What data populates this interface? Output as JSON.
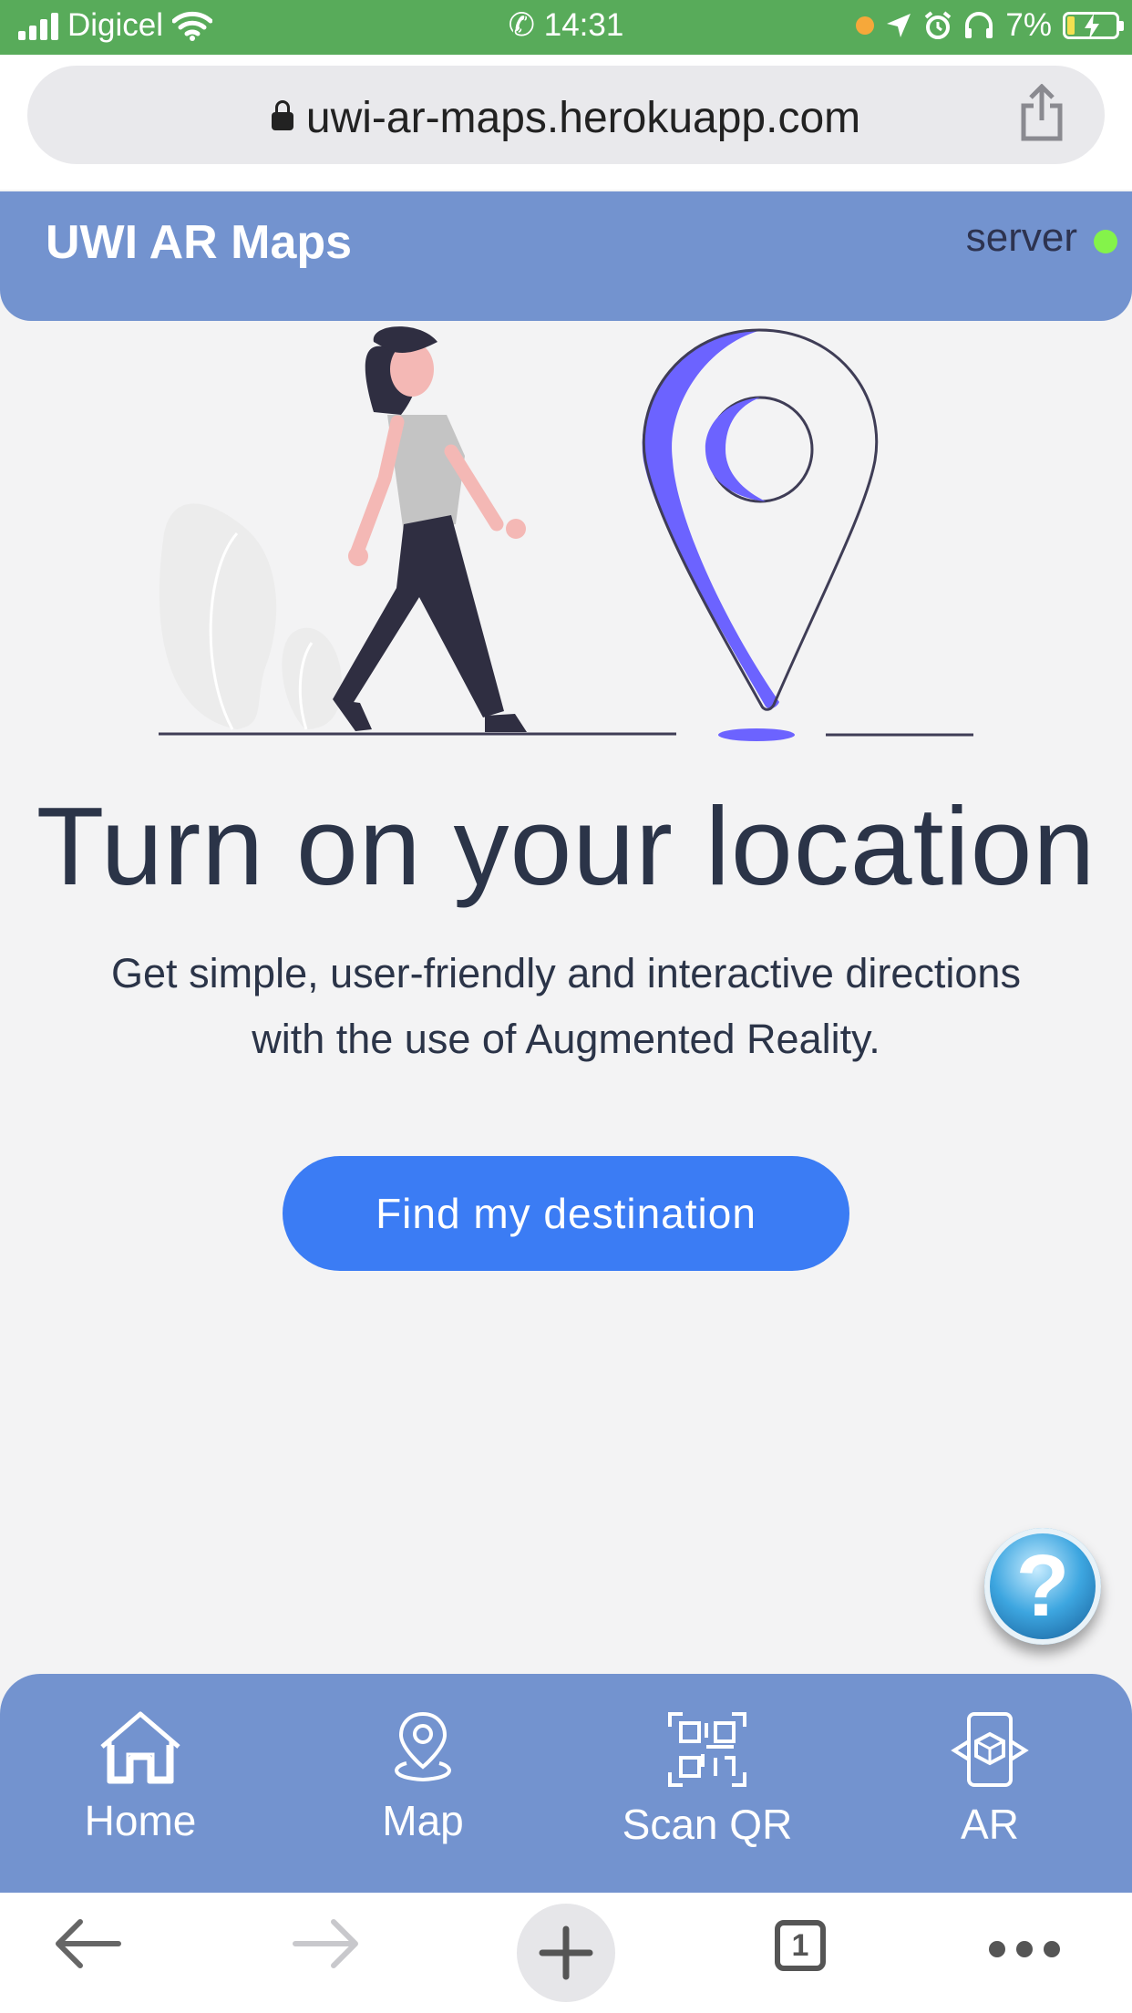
{
  "status_bar": {
    "carrier": "Digicel",
    "time": "14:31",
    "battery": "7%"
  },
  "browser": {
    "url": "uwi-ar-maps.herokuapp.com",
    "tab_count": "1"
  },
  "header": {
    "title": "UWI AR Maps",
    "server_label": "server",
    "server_status_color": "#84f34a"
  },
  "hero": {
    "headline": "Turn on your location",
    "subtitle_line1": "Get simple, user-friendly and interactive directions",
    "subtitle_line2": "with the use of Augmented Reality.",
    "cta_label": "Find my destination"
  },
  "help_button": {
    "label": "?"
  },
  "bottom_nav": {
    "items": [
      {
        "label": "Home",
        "icon": "home-icon"
      },
      {
        "label": "Map",
        "icon": "map-pin-icon"
      },
      {
        "label": "Scan QR",
        "icon": "qr-scan-icon"
      },
      {
        "label": "AR",
        "icon": "ar-phone-icon"
      }
    ]
  },
  "colors": {
    "header_bg": "#7393cf",
    "cta_bg": "#3b7cf4",
    "status_bar_bg": "#58ab5a",
    "accent_purple": "#6c63ff"
  }
}
